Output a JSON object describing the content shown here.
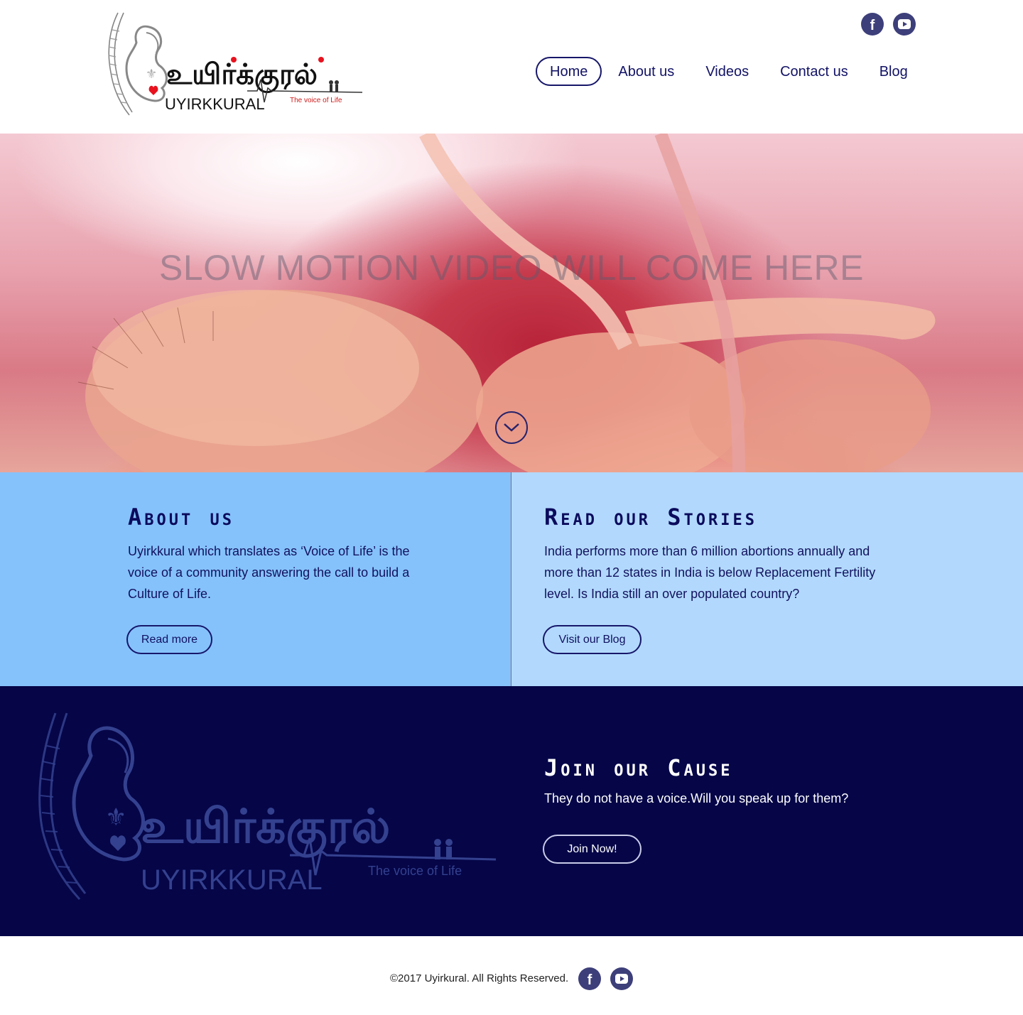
{
  "header": {
    "logo": {
      "tamil_text": "உயிர்க்குரல்",
      "latin_text": "UYIRKKURAL",
      "tagline": "The voice of Life"
    },
    "social": [
      {
        "icon": "facebook-icon",
        "label": "f"
      },
      {
        "icon": "youtube-icon"
      }
    ],
    "nav": [
      {
        "label": "Home",
        "active": true
      },
      {
        "label": "About us",
        "active": false
      },
      {
        "label": "Videos",
        "active": false
      },
      {
        "label": "Contact us",
        "active": false
      },
      {
        "label": "Blog",
        "active": false
      }
    ]
  },
  "hero": {
    "placeholder_text": "SLOW MOTION VIDEO WILL COME HERE",
    "scroll_icon": "chevron-down-icon"
  },
  "about": {
    "title": "About us",
    "text": "Uyirkkural which translates as ‘Voice of Life’ is the voice of a community answering the call to build a Culture of Life.",
    "button": "Read more"
  },
  "stories": {
    "title": "Read our Stories",
    "text": "India performs more than 6 million abortions annually and more than 12 states in India is below Replacement Fertility level. Is India still an over populated country?",
    "button": "Visit our Blog"
  },
  "join": {
    "title": "Join our Cause",
    "text": "They do not have a voice.Will you speak up for them?",
    "button": "Join Now!",
    "logo": {
      "tamil_text": "உயிர்க்குரல்",
      "latin_text": "UYIRKKURAL",
      "tagline": "The voice of Life"
    }
  },
  "footer": {
    "copyright": "©2017 Uyirkural. All Rights Reserved.",
    "social": [
      {
        "icon": "facebook-icon",
        "label": "f"
      },
      {
        "icon": "youtube-icon"
      }
    ]
  },
  "colors": {
    "navy": "#050548",
    "about_bg": "#85c2fc",
    "stories_bg": "#b2d9fd",
    "social_bg": "#3d3f7a"
  }
}
